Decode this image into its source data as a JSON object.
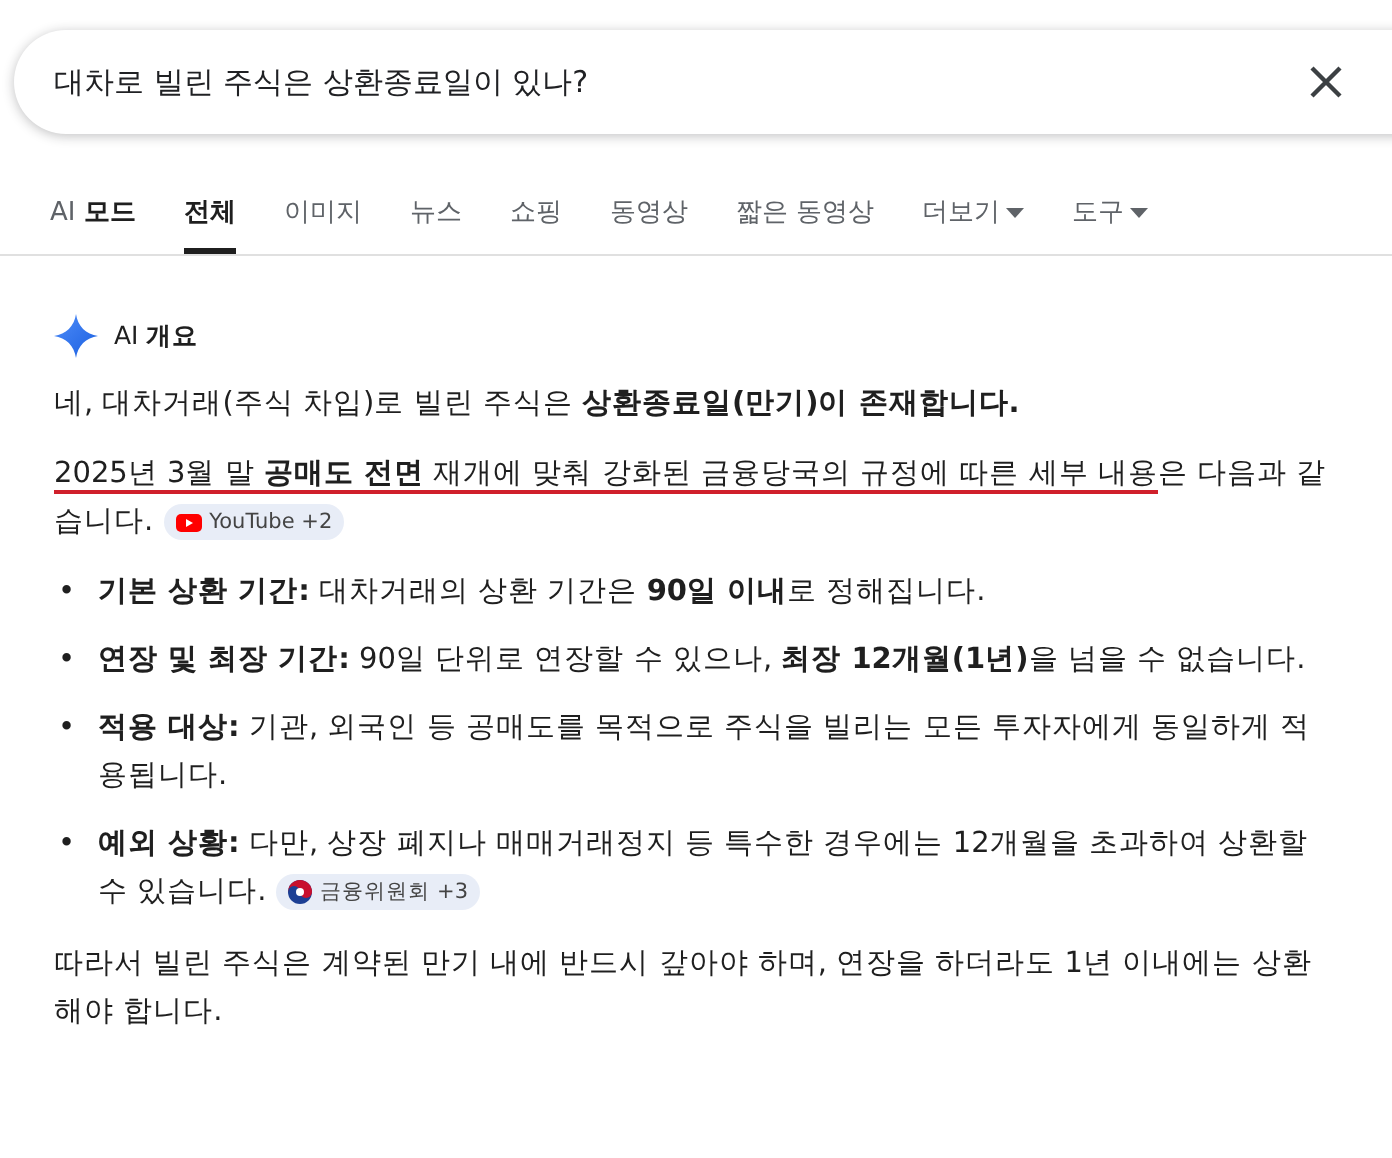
{
  "search": {
    "value": "대차로 빌린 주식은 상환종료일이 있나?"
  },
  "tabs": [
    {
      "label": "AI 모드",
      "kind": "ai",
      "selected": false,
      "dropdown": false
    },
    {
      "label": "전체",
      "kind": "plain",
      "selected": true,
      "dropdown": false
    },
    {
      "label": "이미지",
      "kind": "plain",
      "selected": false,
      "dropdown": false
    },
    {
      "label": "뉴스",
      "kind": "plain",
      "selected": false,
      "dropdown": false
    },
    {
      "label": "쇼핑",
      "kind": "plain",
      "selected": false,
      "dropdown": false
    },
    {
      "label": "동영상",
      "kind": "plain",
      "selected": false,
      "dropdown": false
    },
    {
      "label": "짧은 동영상",
      "kind": "plain",
      "selected": false,
      "dropdown": false
    },
    {
      "label": "더보기",
      "kind": "plain",
      "selected": false,
      "dropdown": true
    },
    {
      "label": "도구",
      "kind": "plain",
      "selected": false,
      "dropdown": true
    }
  ],
  "overview": {
    "title": "AI **개요**",
    "intro": "네, 대차거래(주식 차입)로 빌린 주식은 **상환종료일(만기)이 존재합니다.**",
    "detail": {
      "underlined": "2025년 3월 말 **공매도 전면** 재개에 맞춰 강화된 금융당국의 규정에 따른 세부 내용",
      "line_1_rest": "은 다음과 같",
      "line_2": "습니다.",
      "source": {
        "kind": "youtube",
        "label": "YouTube +2"
      }
    },
    "bullets": [
      {
        "marker": "•",
        "lines": [
          "**기본 상환 기간:** 대차거래의 상환 기간은 **90일 이내**로 정해집니다."
        ]
      },
      {
        "marker": "•",
        "lines": [
          "**연장 및 최장 기간:** 90일 단위로 연장할 수 있으나, **최장 12개월(1년)**을 넘을 수 없습니다."
        ]
      },
      {
        "marker": "•",
        "lines": [
          "**적용 대상:** 기관, 외국인 등 공매도를 목적으로 주식을 빌리는 모든 투자자에게 동일하게 적",
          "용됩니다."
        ]
      },
      {
        "marker": "•",
        "lines": [
          "**예외 상황:** 다만, 상장 폐지나 매매거래정지 등 특수한 경우에는 12개월을 초과하여 상환할",
          "수 있습니다."
        ],
        "source": {
          "kind": "gov",
          "label": "금융위원회 +3"
        }
      }
    ],
    "conclusion": "따라서 빌린 주식은 계약된 만기 내에 반드시 갚아야 하며, 연장을 하더라도 1년 이내에는 상환해야 합니다."
  }
}
